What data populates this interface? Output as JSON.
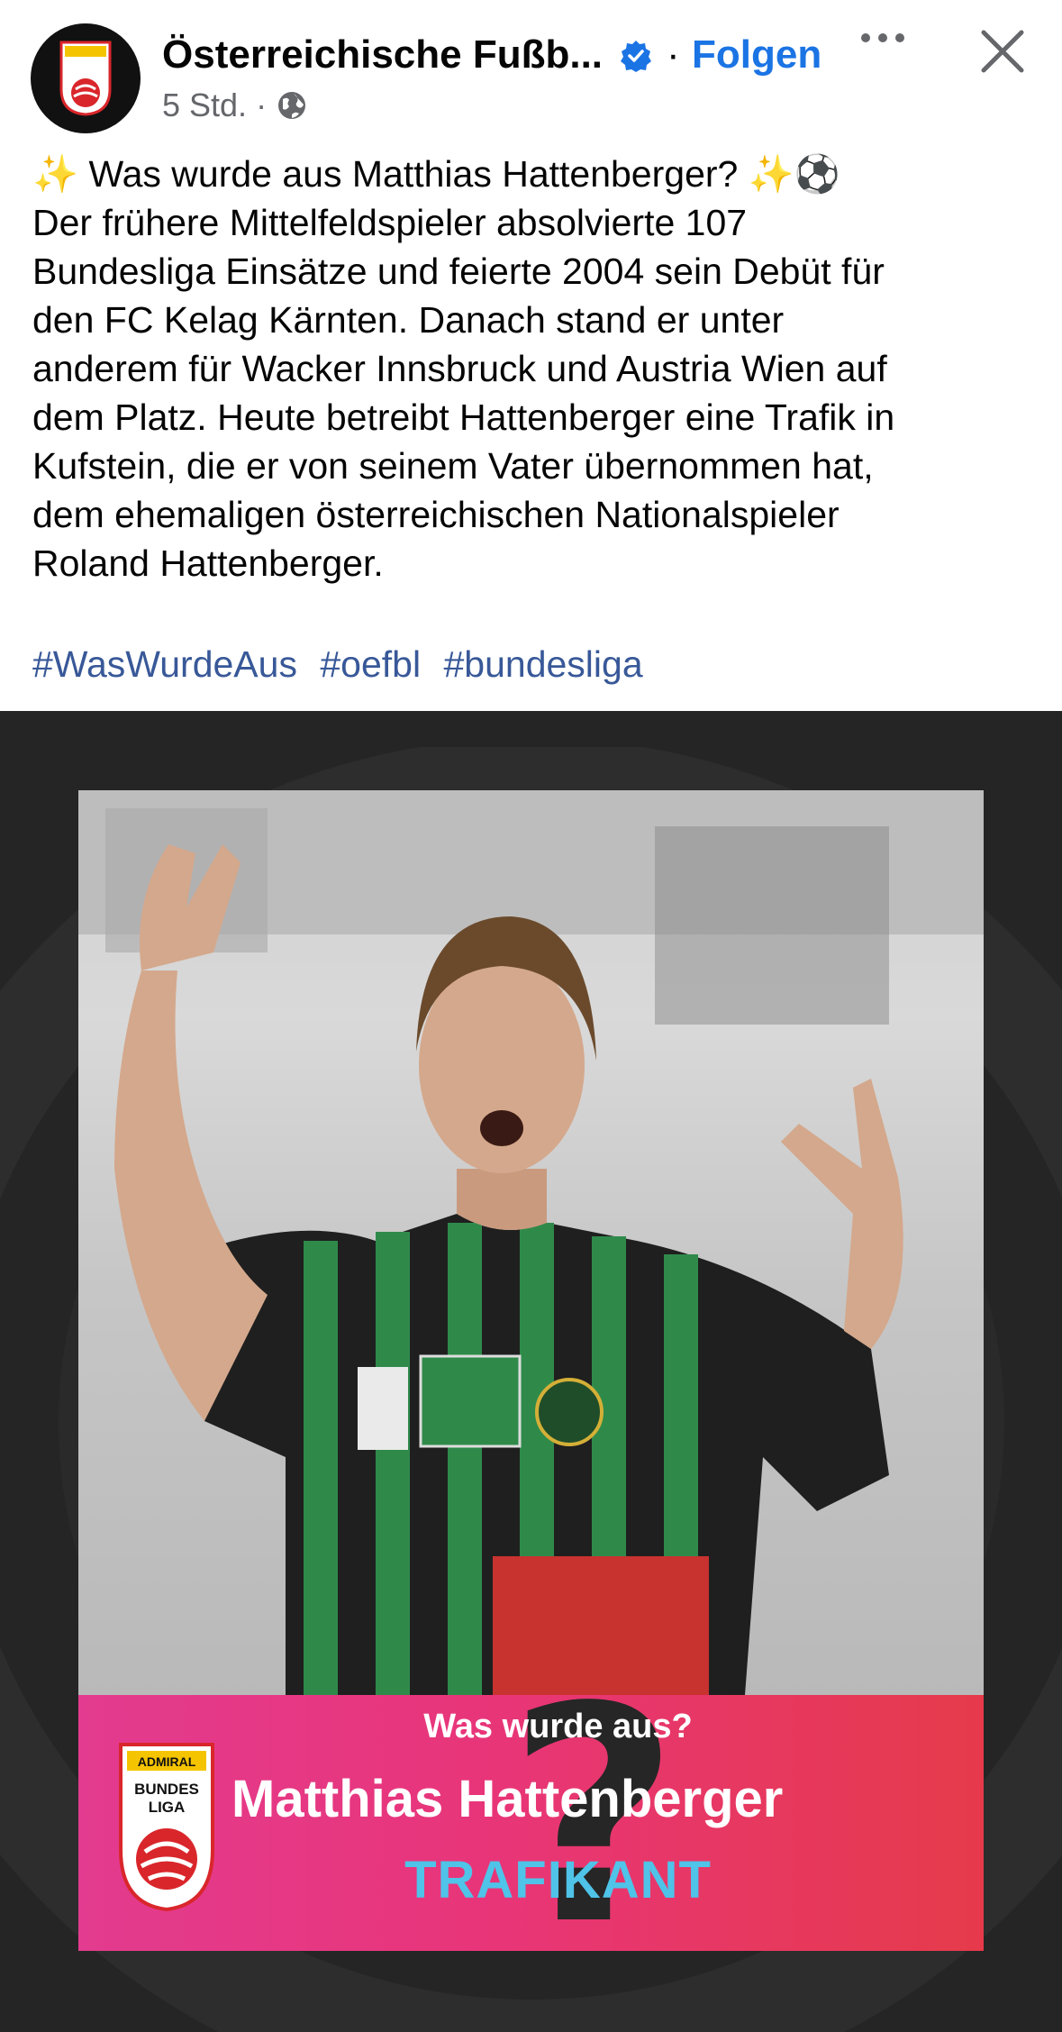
{
  "post": {
    "page_name": "Österreichische Fußb...",
    "separator": "·",
    "follow_label": "Folgen",
    "time": "5 Std.",
    "time_separator": "·",
    "verified": true,
    "privacy_icon": "globe-icon",
    "text_lines": [
      "✨ Was wurde aus Matthias Hattenberger? ✨⚽",
      "Der frühere Mittelfeldspieler absolvierte 107",
      "Bundesliga Einsätze und feierte 2004 sein Debüt für",
      "den FC Kelag Kärnten. Danach stand er unter",
      "anderem für Wacker Innsbruck und Austria Wien auf",
      "dem Platz. Heute betreibt Hattenberger eine Trafik in",
      "Kufstein, die er von seinem Vater übernommen hat,",
      "dem ehemaligen österreichischen Nationalspieler",
      "Roland Hattenberger."
    ],
    "hashtags": [
      "#WasWurdeAus",
      "#oefbl",
      "#bundesliga"
    ]
  },
  "logo": {
    "top": "ADMIRAL",
    "line1": "BUNDES",
    "line2": "LIGA"
  },
  "graphic": {
    "kicker": "Was wurde aus?",
    "name": "Matthias Hattenberger",
    "job": "TRAFIKANT",
    "question_mark": "?"
  },
  "colors": {
    "follow": "#1b74e4",
    "hashtag": "#385898",
    "banner_pink": "#e33b8f",
    "banner_red": "#e63a4b",
    "job_text": "#4fc3e8",
    "media_bg": "#252525"
  }
}
